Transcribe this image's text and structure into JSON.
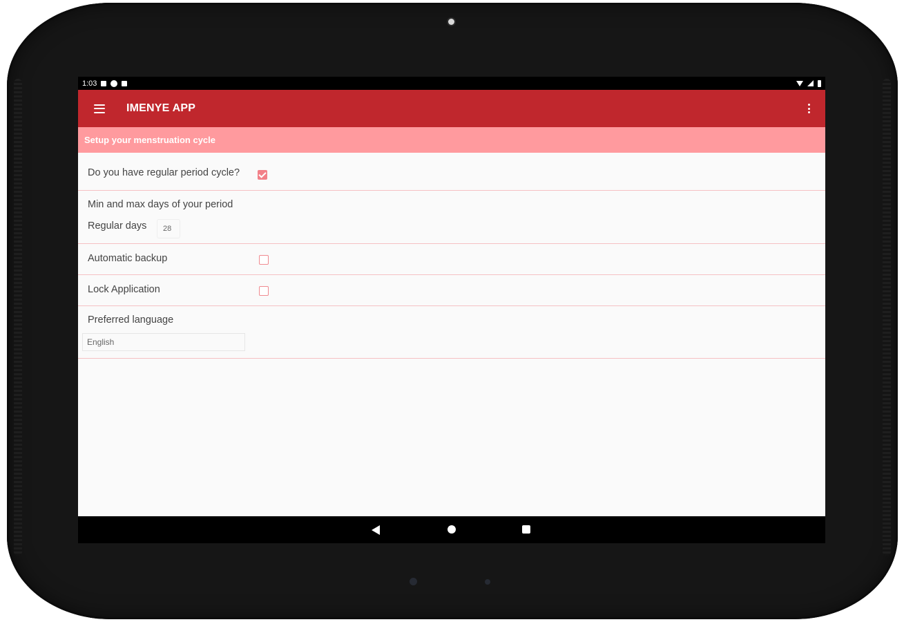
{
  "status_bar": {
    "time": "1:03"
  },
  "app_bar": {
    "title": "IMENYE APP"
  },
  "section": {
    "title": "Setup your menstruation cycle"
  },
  "settings": {
    "regular_cycle": {
      "label": "Do you have regular period cycle?",
      "checked": true
    },
    "period_days": {
      "label": "Min and max days of your period",
      "regular_label": "Regular days",
      "regular_value": "28"
    },
    "auto_backup": {
      "label": "Automatic backup",
      "checked": false
    },
    "lock_app": {
      "label": "Lock Application",
      "checked": false
    },
    "language": {
      "label": "Preferred language",
      "selected": "English"
    }
  },
  "colors": {
    "app_bar": "#c0272d",
    "section_header": "#ff9a9e",
    "accent": "#f28088"
  },
  "icons": {
    "menu": "hamburger-icon",
    "more": "overflow-menu-icon",
    "nav_back": "back-triangle-icon",
    "nav_home": "home-circle-icon",
    "nav_recent": "recent-square-icon"
  }
}
